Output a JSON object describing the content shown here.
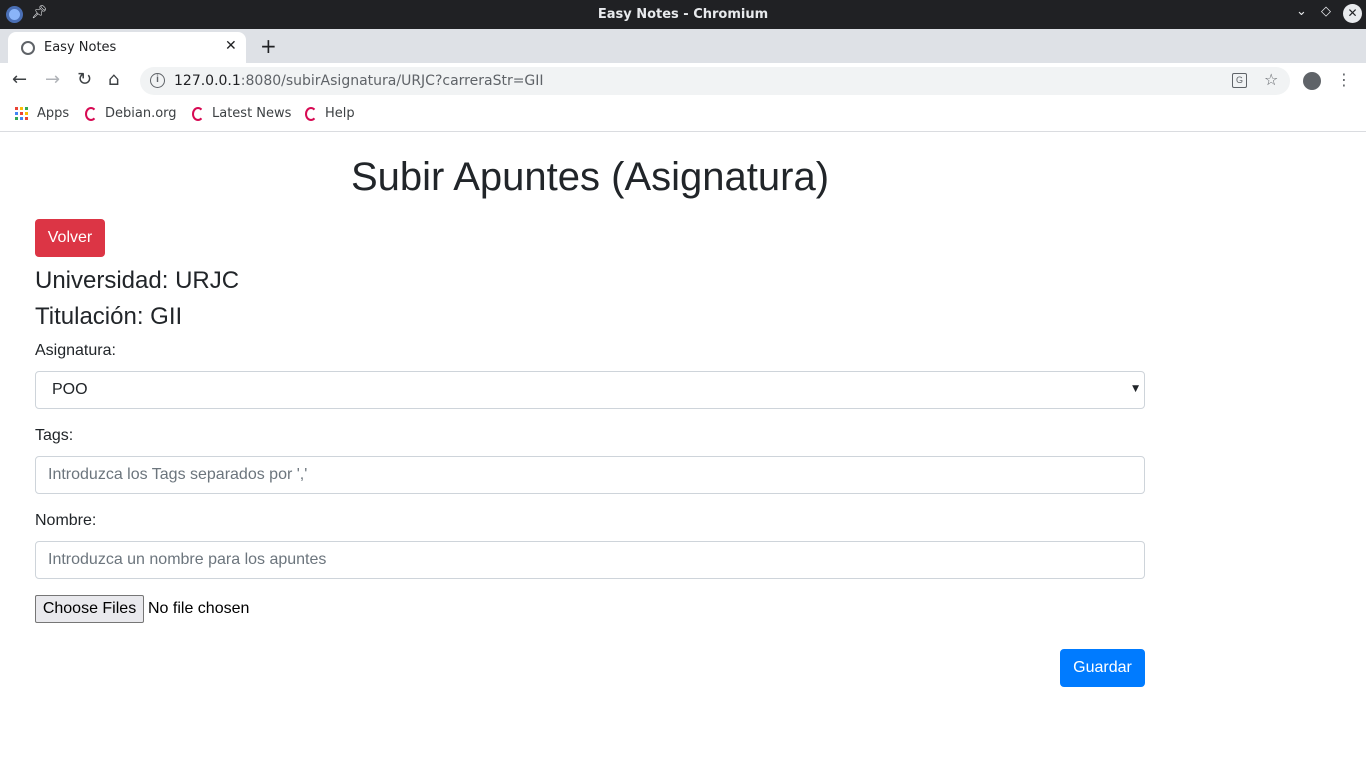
{
  "window": {
    "title": "Easy Notes - Chromium",
    "app_icon": "chromium-icon",
    "controls": [
      "chevron-down-icon",
      "restore-icon",
      "close-icon"
    ]
  },
  "tabs": [
    {
      "title": "Easy Notes",
      "icon": "globe-icon",
      "active": true
    }
  ],
  "toolbar": {
    "url_host": "127.0.0.1",
    "url_rest": ":8080/subirAsignatura/URJC?carreraStr=GII"
  },
  "bookmarks": [
    {
      "label": "Apps",
      "icon": "apps-grid-icon"
    },
    {
      "label": "Debian.org",
      "icon": "debian-icon"
    },
    {
      "label": "Latest News",
      "icon": "debian-icon"
    },
    {
      "label": "Help",
      "icon": "debian-icon"
    }
  ],
  "page": {
    "title": "Subir Apuntes (Asignatura)",
    "back_button": "Volver",
    "universidad": "Universidad: URJC",
    "titulacion": "Titulación: GII",
    "asignatura_label": "Asignatura:",
    "asignatura_value": "POO",
    "tags_label": "Tags:",
    "tags_placeholder": "Introduzca los Tags separados por ','",
    "nombre_label": "Nombre:",
    "nombre_placeholder": "Introduzca un nombre para los apuntes",
    "file_button": "Choose Files",
    "file_status": "No file chosen",
    "save_button": "Guardar"
  },
  "colors": {
    "danger": "#dc3545",
    "primary": "#007bff",
    "titlebar": "#202124",
    "tabstrip": "#dee1e6"
  }
}
